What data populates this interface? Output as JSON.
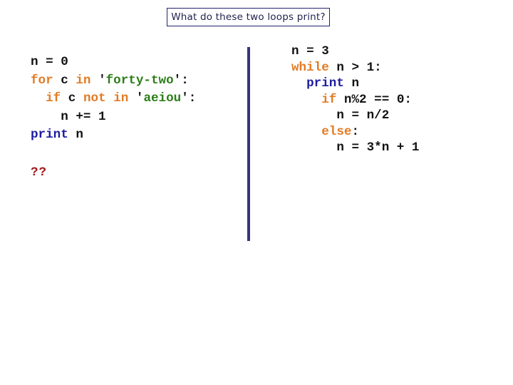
{
  "title": "What do these two loops print?",
  "colors": {
    "keyword": "#e27b25",
    "print_keyword": "#1c1ca0",
    "string": "#2b7d18",
    "default": "#111111",
    "answer": "#a0181c",
    "divider": "#35357f",
    "title_border": "#22226e"
  },
  "left_program": {
    "lines": [
      [
        {
          "t": "n = 0",
          "k": "plain"
        }
      ],
      [
        {
          "t": "for",
          "k": "kw"
        },
        {
          "t": " c ",
          "k": "plain"
        },
        {
          "t": "in",
          "k": "kw"
        },
        {
          "t": " ",
          "k": "plain"
        },
        {
          "t": "'",
          "k": "q"
        },
        {
          "t": "forty-two",
          "k": "str"
        },
        {
          "t": "'",
          "k": "q"
        },
        {
          "t": ":",
          "k": "plain"
        }
      ],
      [
        {
          "t": "  ",
          "k": "plain"
        },
        {
          "t": "if",
          "k": "kw"
        },
        {
          "t": " c ",
          "k": "plain"
        },
        {
          "t": "not",
          "k": "kw"
        },
        {
          "t": " ",
          "k": "plain"
        },
        {
          "t": "in",
          "k": "kw"
        },
        {
          "t": " ",
          "k": "plain"
        },
        {
          "t": "'",
          "k": "q"
        },
        {
          "t": "aeiou",
          "k": "str"
        },
        {
          "t": "'",
          "k": "q"
        },
        {
          "t": ":",
          "k": "plain"
        }
      ],
      [
        {
          "t": "    n += 1",
          "k": "plain"
        }
      ],
      [
        {
          "t": "print",
          "k": "pr"
        },
        {
          "t": " n",
          "k": "plain"
        }
      ]
    ],
    "answer": "??"
  },
  "right_program": {
    "lines": [
      [
        {
          "t": "n = 3",
          "k": "plain"
        }
      ],
      [
        {
          "t": "while",
          "k": "kw"
        },
        {
          "t": " n > 1:",
          "k": "plain"
        }
      ],
      [
        {
          "t": "  ",
          "k": "plain"
        },
        {
          "t": "print",
          "k": "pr"
        },
        {
          "t": " n",
          "k": "plain"
        }
      ],
      [
        {
          "t": "    ",
          "k": "plain"
        },
        {
          "t": "if",
          "k": "kw"
        },
        {
          "t": " n%2 == 0:",
          "k": "plain"
        }
      ],
      [
        {
          "t": "      n = n/2",
          "k": "plain"
        }
      ],
      [
        {
          "t": "    ",
          "k": "plain"
        },
        {
          "t": "else",
          "k": "kw"
        },
        {
          "t": ":",
          "k": "plain"
        }
      ],
      [
        {
          "t": "      n = 3*n + 1",
          "k": "plain"
        }
      ]
    ]
  }
}
